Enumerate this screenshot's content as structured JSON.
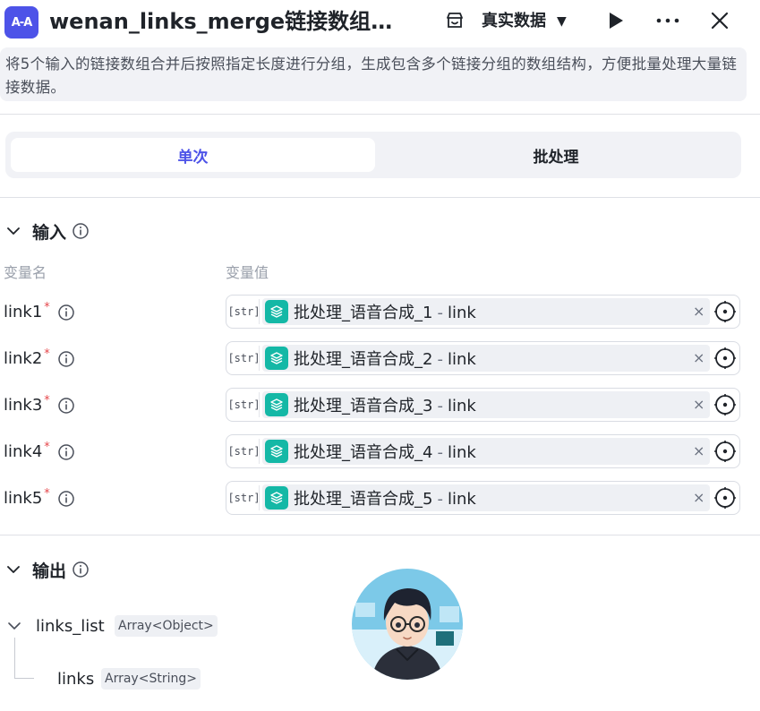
{
  "header": {
    "app_icon_text": "A-A",
    "title": "wenan_links_merge链接数组合…",
    "mode_label": "真实数据",
    "mode_caret": "▼"
  },
  "description": "将5个输入的链接数组合并后按照指定长度进行分组，生成包含多个链接分组的数组结构，方便批量处理大量链接数据。",
  "tabs": [
    {
      "label": "单次",
      "active": true
    },
    {
      "label": "批处理",
      "active": false
    }
  ],
  "input_section": {
    "title": "输入",
    "col_name": "变量名",
    "col_value": "变量值",
    "rows": [
      {
        "name": "link1",
        "required": "*",
        "type": "[str]",
        "ref_node": "批处理_语音合成_1",
        "ref_sep": "-",
        "ref_field": "link",
        "clear": "×"
      },
      {
        "name": "link2",
        "required": "*",
        "type": "[str]",
        "ref_node": "批处理_语音合成_2",
        "ref_sep": "-",
        "ref_field": "link",
        "clear": "×"
      },
      {
        "name": "link3",
        "required": "*",
        "type": "[str]",
        "ref_node": "批处理_语音合成_3",
        "ref_sep": "-",
        "ref_field": "link",
        "clear": "×"
      },
      {
        "name": "link4",
        "required": "*",
        "type": "[str]",
        "ref_node": "批处理_语音合成_4",
        "ref_sep": "-",
        "ref_field": "link",
        "clear": "×"
      },
      {
        "name": "link5",
        "required": "*",
        "type": "[str]",
        "ref_node": "批处理_语音合成_5",
        "ref_sep": "-",
        "ref_field": "link",
        "clear": "×"
      }
    ]
  },
  "output_section": {
    "title": "输出",
    "items": [
      {
        "name": "links_list",
        "type": "Array<Object>"
      },
      {
        "name": "links",
        "type": "Array<String>"
      }
    ]
  },
  "colors": {
    "accent": "#4d53e8",
    "node_icon": "#14b8a6",
    "required": "#e5484d"
  }
}
